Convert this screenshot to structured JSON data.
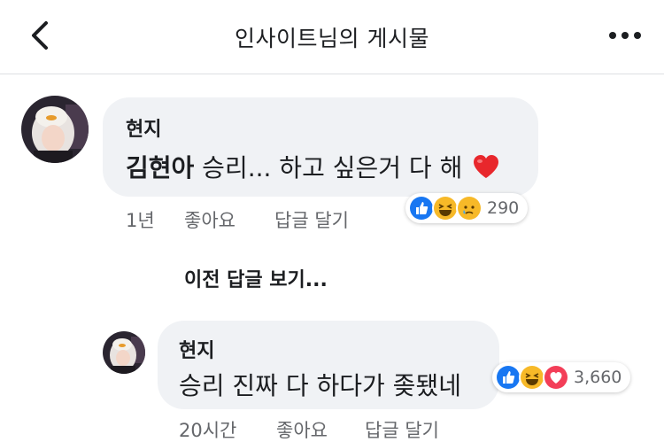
{
  "header": {
    "title": "인사이트님의 게시물",
    "back_icon": "chevron-left-icon",
    "more_icon": "more-dots-icon"
  },
  "comment": {
    "author": "현지",
    "mention": "김현아",
    "text": " 승리... 하고 싶은거 다 해",
    "emoji": "❤️",
    "time": "1년",
    "like_label": "좋아요",
    "reply_label": "답글 달기",
    "reactions": [
      "like",
      "haha",
      "sad"
    ],
    "reaction_count": "290"
  },
  "view_previous_replies": "이전 답글 보기...",
  "reply": {
    "author": "현지",
    "text": "승리 진짜 다 하다가 좆됐네",
    "time": "20시간",
    "like_label": "좋아요",
    "reply_label": "답글 달기",
    "reactions": [
      "like",
      "haha",
      "love"
    ],
    "reaction_count": "3,660"
  },
  "colors": {
    "like_blue": "#1877f2",
    "haha_yellow": "#f7b928",
    "love_red": "#f33e58",
    "bubble_gray": "#f0f2f5",
    "meta_gray": "#65676b"
  }
}
